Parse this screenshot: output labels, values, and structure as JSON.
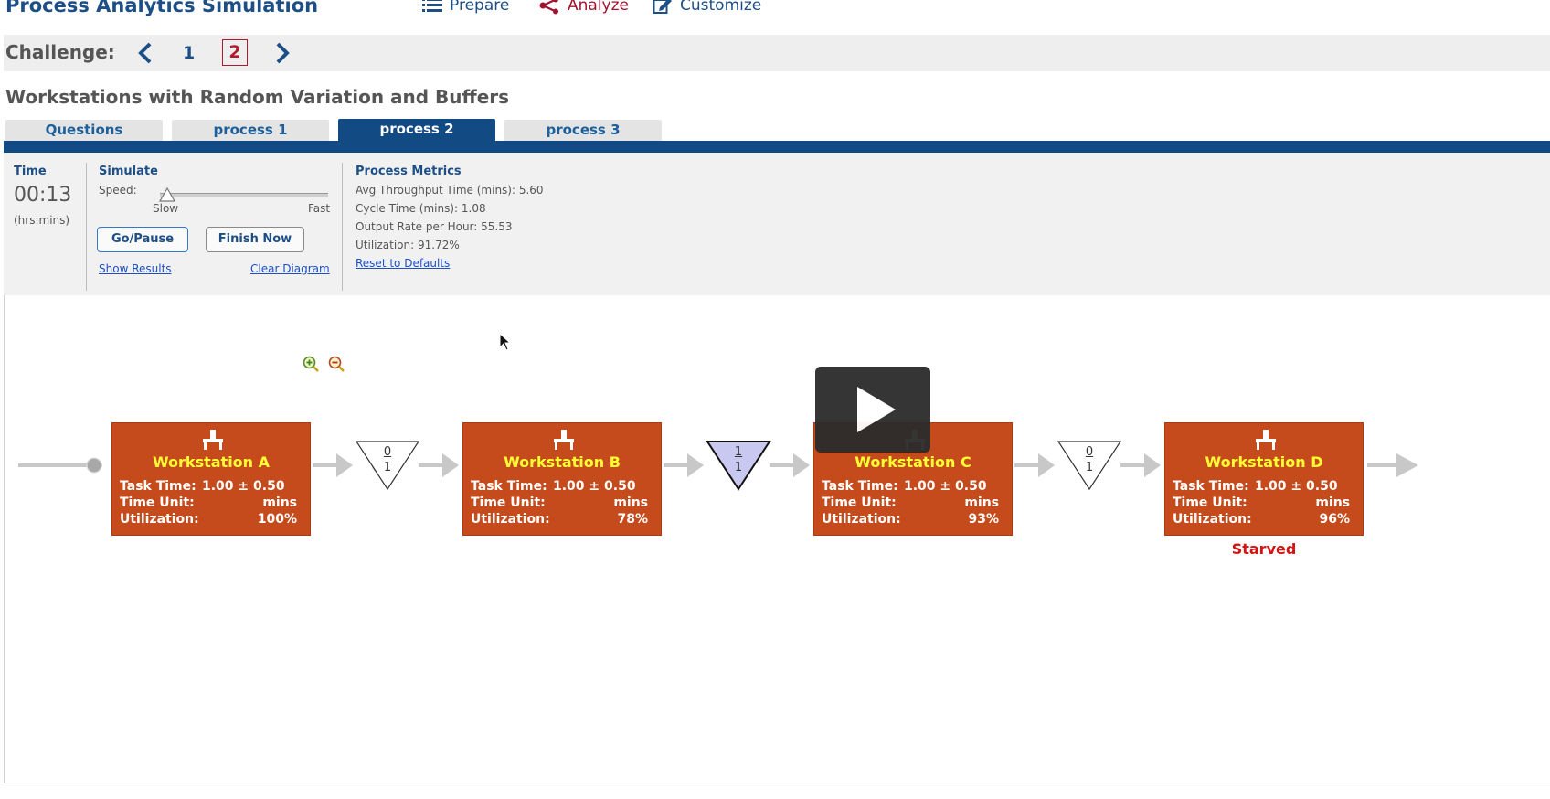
{
  "header": {
    "title": "Process Analytics Simulation",
    "nav": {
      "prepare": "Prepare",
      "analyze": "Analyze",
      "customize": "Customize"
    }
  },
  "challenge": {
    "label": "Challenge:",
    "pages": [
      "1",
      "2"
    ],
    "current": "2"
  },
  "section_title": "Workstations with Random Variation and Buffers",
  "tabs": [
    "Questions",
    "process 1",
    "process 2",
    "process 3"
  ],
  "active_tab": "process 2",
  "time": {
    "label": "Time",
    "value": "00:13",
    "unit": "(hrs:mins)"
  },
  "simulate": {
    "label": "Simulate",
    "speed_label": "Speed:",
    "slow": "Slow",
    "fast": "Fast",
    "speed_level": 0.0,
    "go_pause": "Go/Pause",
    "finish_now": "Finish Now",
    "show_results": "Show Results",
    "clear_diagram": "Clear Diagram"
  },
  "metrics": {
    "label": "Process Metrics",
    "avg_throughput": "Avg Throughput Time (mins): 5.60",
    "cycle_time": "Cycle Time (mins): 1.08",
    "output_rate": "Output Rate per Hour: 55.53",
    "utilization": "Utilization: 91.72%",
    "reset": "Reset to Defaults"
  },
  "labels": {
    "task_time": "Task Time:",
    "time_unit": "Time Unit:",
    "utilization": "Utilization:"
  },
  "workstations": [
    {
      "name": "Workstation A",
      "task_time": "1.00 ± 0.50",
      "time_unit": "mins",
      "utilization": "100%",
      "status": ""
    },
    {
      "name": "Workstation B",
      "task_time": "1.00 ± 0.50",
      "time_unit": "mins",
      "utilization": "78%",
      "status": ""
    },
    {
      "name": "Workstation C",
      "task_time": "1.00 ± 0.50",
      "time_unit": "mins",
      "utilization": "93%",
      "status": ""
    },
    {
      "name": "Workstation D",
      "task_time": "1.00 ± 0.50",
      "time_unit": "mins",
      "utilization": "96%",
      "status": "Starved"
    }
  ],
  "buffers": [
    {
      "count": "0",
      "capacity": "1",
      "fill": "#ffffff"
    },
    {
      "count": "1",
      "capacity": "1",
      "fill": "#c8c8f0"
    },
    {
      "count": "0",
      "capacity": "1",
      "fill": "#ffffff"
    }
  ],
  "colors": {
    "brand": "#1d4f86",
    "workstation": "#c54b1c",
    "ws_name": "#ffff33",
    "starved": "#d21414"
  }
}
